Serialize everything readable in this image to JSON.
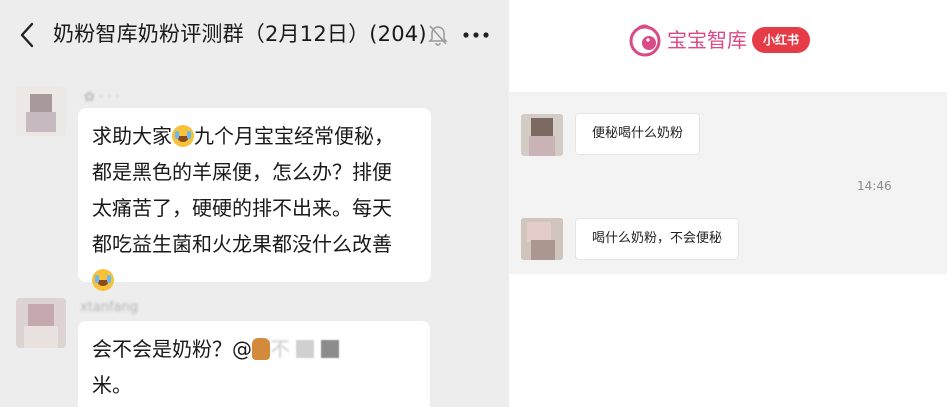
{
  "left_chat": {
    "title": "奶粉智库奶粉评测群（2月12日）(204)",
    "icons": {
      "back": "back-arrow-icon",
      "mute": "mute-bell-icon",
      "more": "more-dots-icon"
    },
    "messages": [
      {
        "sender": "✿ · · ·",
        "lines": [
          "求助大家",
          "九个月宝宝经常便秘，",
          "都是黑色的羊屎便，怎么办？排便",
          "太痛苦了，硬硬的排不出来。每天",
          "都吃益生菌和火龙果都没什么改善"
        ]
      },
      {
        "sender": "xtanfang",
        "line1_prefix": "会不会是奶粉？@",
        "line1_masked": "不",
        "line2": "米。"
      }
    ]
  },
  "right_panel": {
    "brand": {
      "name": "宝宝智库",
      "badge": "小红书",
      "accent": "#d94a86",
      "badge_color": "#e53c48"
    },
    "messages": [
      {
        "text": "便秘喝什么奶粉"
      },
      {
        "text": "喝什么奶粉，不会便秘"
      }
    ],
    "timestamp": "14:46"
  }
}
